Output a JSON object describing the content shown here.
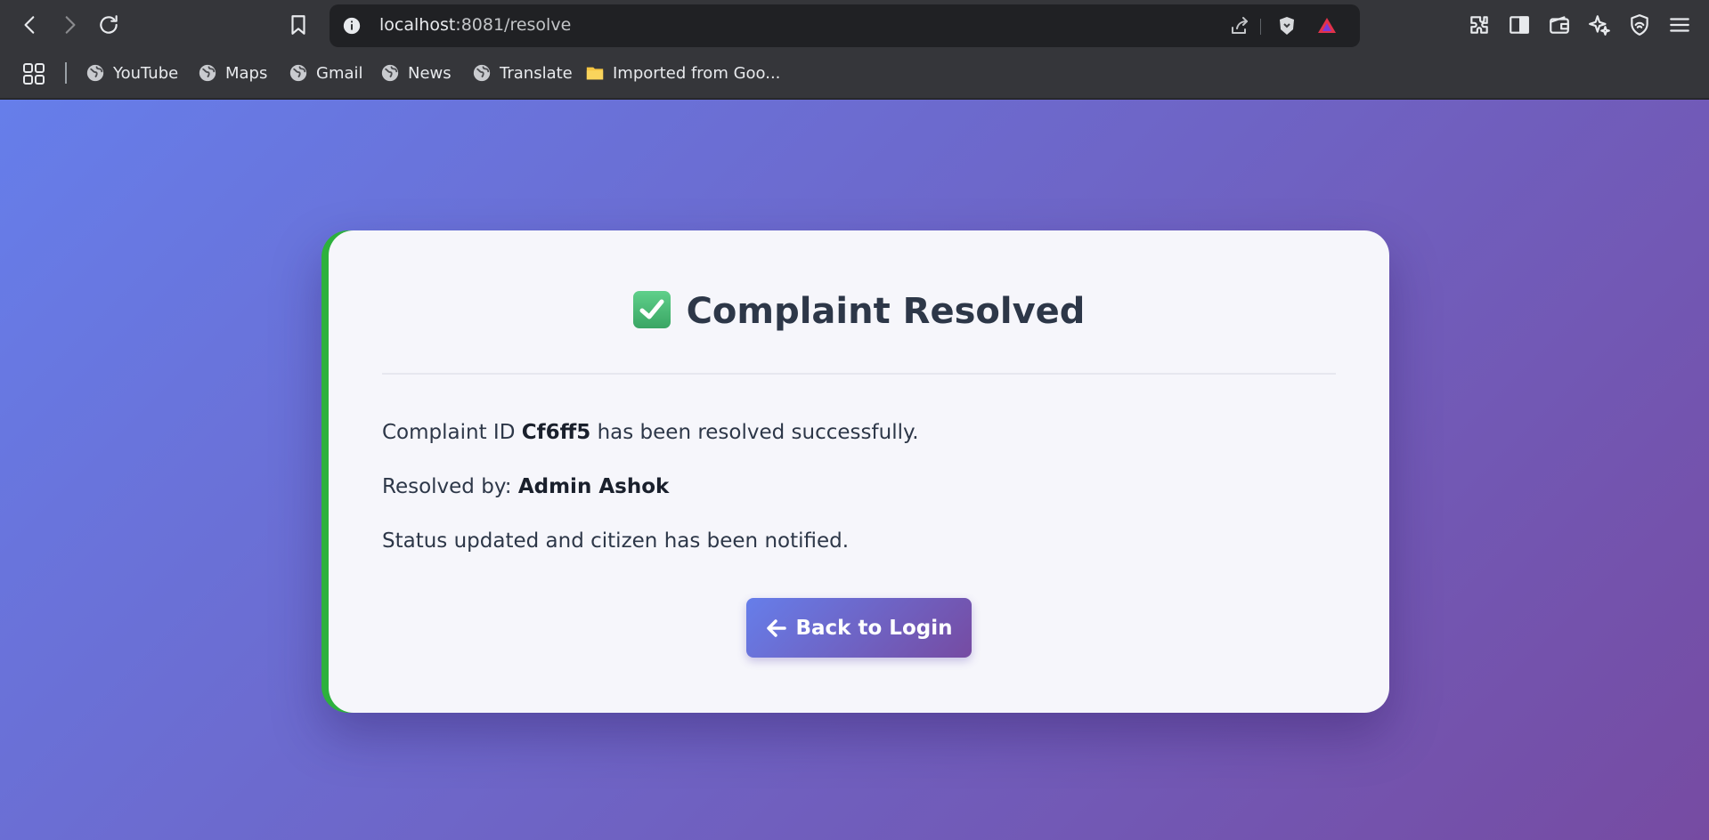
{
  "browser": {
    "url_host": "localhost",
    "url_path": ":8081/resolve",
    "bookmarks": [
      {
        "label": "YouTube",
        "icon": "globe-icon"
      },
      {
        "label": "Maps",
        "icon": "globe-icon"
      },
      {
        "label": "Gmail",
        "icon": "globe-icon"
      },
      {
        "label": "News",
        "icon": "globe-icon"
      },
      {
        "label": "Translate",
        "icon": "globe-icon"
      },
      {
        "label": "Imported from Goo...",
        "icon": "folder-icon"
      }
    ]
  },
  "card": {
    "title": "Complaint Resolved",
    "id_prefix": "Complaint ID ",
    "complaint_id": "Cf6ff5",
    "id_suffix": " has been resolved successfully.",
    "resolved_by_label": "Resolved by: ",
    "resolved_by": "Admin Ashok",
    "status_text": "Status updated and citizen has been notified.",
    "button_label": "Back to Login"
  },
  "colors": {
    "gradient_start": "#667eea",
    "gradient_end": "#764ba2",
    "accent_border": "#2db13d",
    "card_bg": "#f6f6fb",
    "text": "#2d3748"
  }
}
